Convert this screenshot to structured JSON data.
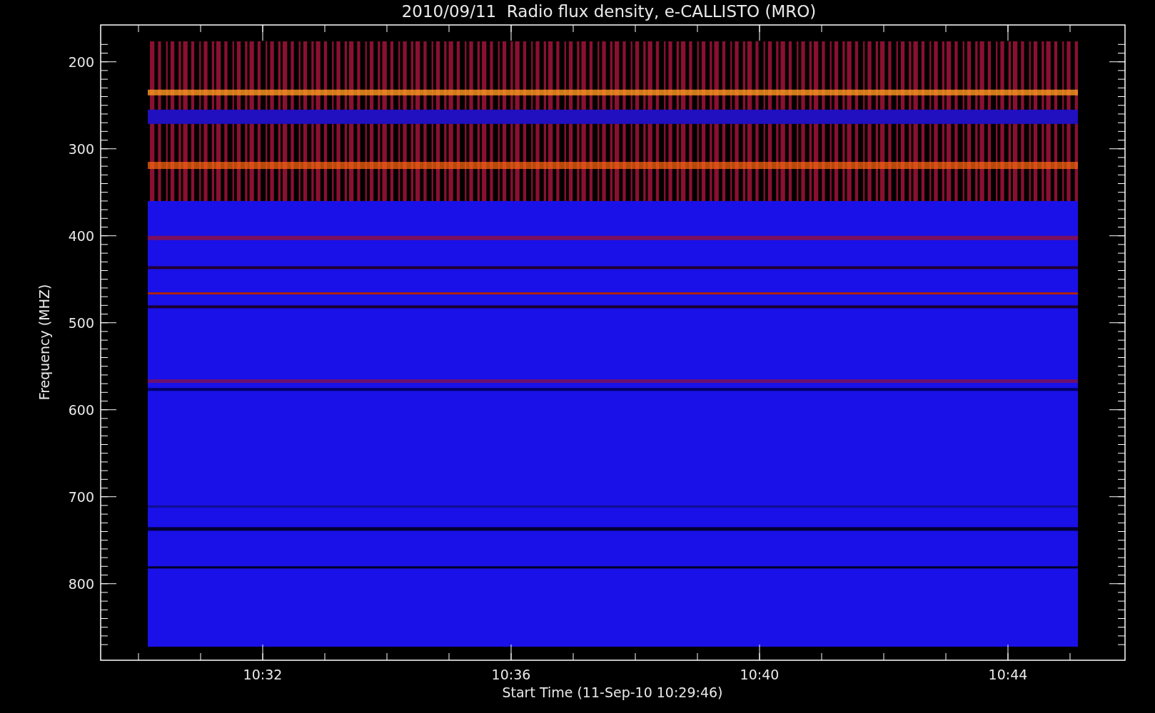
{
  "title": "2010/09/11  Radio flux density, e-CALLISTO (MRO)",
  "x_axis": {
    "title": "Start Time (11-Sep-10 10:29:46)",
    "ticks": [
      "10:32",
      "10:36",
      "10:40",
      "10:44"
    ]
  },
  "y_axis": {
    "title": "Frequency (MHZ)",
    "ticks": [
      "200",
      "300",
      "400",
      "500",
      "600",
      "700",
      "800"
    ]
  }
}
